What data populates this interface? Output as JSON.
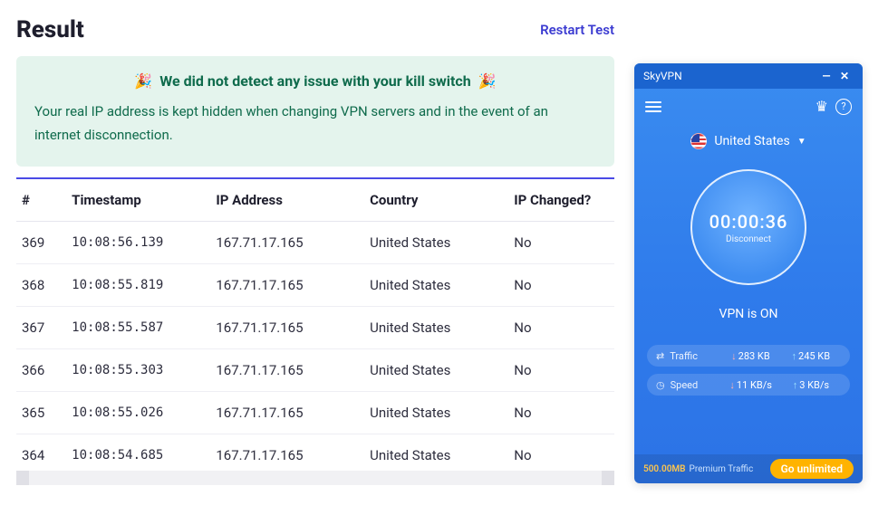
{
  "header": {
    "title": "Result",
    "restart_label": "Restart Test"
  },
  "banner": {
    "title": "We did not detect any issue with your kill switch",
    "subtitle": "Your real IP address is kept hidden when changing VPN servers and in the event of an internet disconnection."
  },
  "table": {
    "headers": {
      "num": "#",
      "ts": "Timestamp",
      "ip": "IP Address",
      "country": "Country",
      "changed": "IP Changed?"
    },
    "rows": [
      {
        "num": "369",
        "ts": "10:08:56.139",
        "ip": "167.71.17.165",
        "country": "United States",
        "changed": "No"
      },
      {
        "num": "368",
        "ts": "10:08:55.819",
        "ip": "167.71.17.165",
        "country": "United States",
        "changed": "No"
      },
      {
        "num": "367",
        "ts": "10:08:55.587",
        "ip": "167.71.17.165",
        "country": "United States",
        "changed": "No"
      },
      {
        "num": "366",
        "ts": "10:08:55.303",
        "ip": "167.71.17.165",
        "country": "United States",
        "changed": "No"
      },
      {
        "num": "365",
        "ts": "10:08:55.026",
        "ip": "167.71.17.165",
        "country": "United States",
        "changed": "No"
      },
      {
        "num": "364",
        "ts": "10:08:54.685",
        "ip": "167.71.17.165",
        "country": "United States",
        "changed": "No"
      }
    ]
  },
  "vpn": {
    "app_name": "SkyVPN",
    "country": "United States",
    "timer": "00:00:36",
    "disconnect_label": "Disconnect",
    "status": "VPN is ON",
    "traffic": {
      "label": "Traffic",
      "down": "283 KB",
      "up": "245 KB"
    },
    "speed": {
      "label": "Speed",
      "down": "11 KB/s",
      "up": "3 KB/s"
    },
    "premium_amount": "500.00MB",
    "premium_label": "Premium Traffic",
    "go_label": "Go unlimited"
  }
}
